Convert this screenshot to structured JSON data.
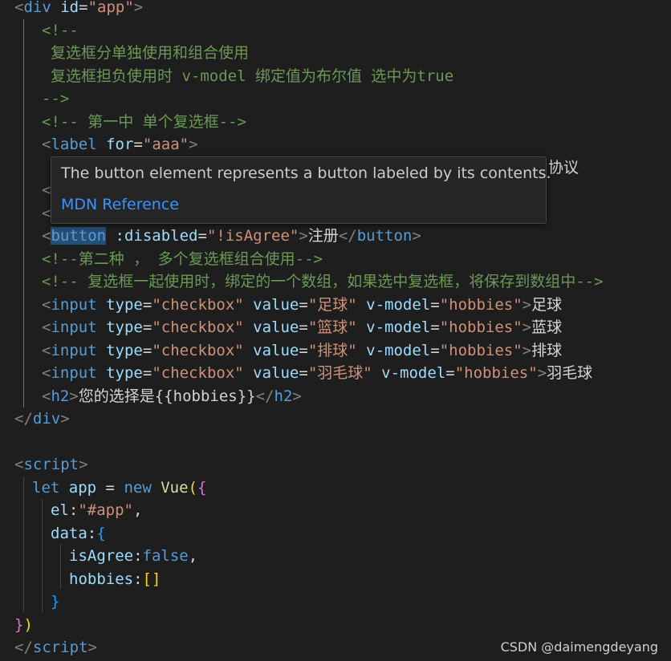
{
  "editor": {
    "lines": [
      [
        [
          "t-punc",
          "<"
        ],
        [
          "t-tag",
          "div"
        ],
        [
          "t-text",
          " "
        ],
        [
          "t-attr",
          "id"
        ],
        [
          "t-text",
          "="
        ],
        [
          "t-str",
          "\"app\""
        ],
        [
          "t-punc",
          ">"
        ]
      ],
      [
        [
          "t-cmt",
          "<!--"
        ]
      ],
      [
        [
          "t-cmt",
          "复选框分单独使用和组合使用"
        ]
      ],
      [
        [
          "t-cmt",
          "复选框担负使用时 v-model 绑定值为布尔值 选中为true"
        ]
      ],
      [
        [
          "t-cmt",
          "-->"
        ]
      ],
      [
        [
          "t-cmt",
          "<!-- 第一中 单个复选框-->"
        ]
      ],
      [
        [
          "t-punc",
          "<"
        ],
        [
          "t-tag",
          "label"
        ],
        [
          "t-text",
          " "
        ],
        [
          "t-attr",
          "for"
        ],
        [
          "t-text",
          "="
        ],
        [
          "t-str",
          "\"aaa\""
        ],
        [
          "t-punc",
          ">"
        ]
      ],
      [
        [
          "t-text",
          "协议"
        ]
      ],
      [
        [
          "t-punc",
          "<"
        ]
      ],
      [
        [
          "t-punc",
          "<"
        ]
      ],
      [
        [
          "t-punc",
          "<"
        ],
        [
          "t-tag sel",
          "button"
        ],
        [
          "t-text",
          " "
        ],
        [
          "t-attr",
          ":disabled"
        ],
        [
          "t-text",
          "="
        ],
        [
          "t-str",
          "\"!isAgree\""
        ],
        [
          "t-punc",
          ">"
        ],
        [
          "t-text",
          "注册"
        ],
        [
          "t-punc",
          "</"
        ],
        [
          "t-tag",
          "button"
        ],
        [
          "t-punc",
          ">"
        ]
      ],
      [
        [
          "t-cmt",
          "<!--第二种 ， 多个复选框组合使用-->"
        ]
      ],
      [
        [
          "t-cmt",
          "<!-- 复选框一起使用时，绑定的一个数组，如果选中复选框，将保存到数组中-->"
        ]
      ],
      [
        [
          "t-punc",
          "<"
        ],
        [
          "t-tag",
          "input"
        ],
        [
          "t-text",
          " "
        ],
        [
          "t-attr",
          "type"
        ],
        [
          "t-text",
          "="
        ],
        [
          "t-str",
          "\"checkbox\""
        ],
        [
          "t-text",
          " "
        ],
        [
          "t-attr",
          "value"
        ],
        [
          "t-text",
          "="
        ],
        [
          "t-str",
          "\"足球\""
        ],
        [
          "t-text",
          " "
        ],
        [
          "t-attr",
          "v-model"
        ],
        [
          "t-text",
          "="
        ],
        [
          "t-str",
          "\"hobbies\""
        ],
        [
          "t-punc",
          ">"
        ],
        [
          "t-text",
          "足球"
        ]
      ],
      [
        [
          "t-punc",
          "<"
        ],
        [
          "t-tag",
          "input"
        ],
        [
          "t-text",
          " "
        ],
        [
          "t-attr",
          "type"
        ],
        [
          "t-text",
          "="
        ],
        [
          "t-str",
          "\"checkbox\""
        ],
        [
          "t-text",
          " "
        ],
        [
          "t-attr",
          "value"
        ],
        [
          "t-text",
          "="
        ],
        [
          "t-str",
          "\"篮球\""
        ],
        [
          "t-text",
          " "
        ],
        [
          "t-attr",
          "v-model"
        ],
        [
          "t-text",
          "="
        ],
        [
          "t-str",
          "\"hobbies\""
        ],
        [
          "t-punc",
          ">"
        ],
        [
          "t-text",
          "蓝球"
        ]
      ],
      [
        [
          "t-punc",
          "<"
        ],
        [
          "t-tag",
          "input"
        ],
        [
          "t-text",
          " "
        ],
        [
          "t-attr",
          "type"
        ],
        [
          "t-text",
          "="
        ],
        [
          "t-str",
          "\"checkbox\""
        ],
        [
          "t-text",
          " "
        ],
        [
          "t-attr",
          "value"
        ],
        [
          "t-text",
          "="
        ],
        [
          "t-str",
          "\"排球\""
        ],
        [
          "t-text",
          " "
        ],
        [
          "t-attr",
          "v-model"
        ],
        [
          "t-text",
          "="
        ],
        [
          "t-str",
          "\"hobbies\""
        ],
        [
          "t-punc",
          ">"
        ],
        [
          "t-text",
          "排球"
        ]
      ],
      [
        [
          "t-punc",
          "<"
        ],
        [
          "t-tag",
          "input"
        ],
        [
          "t-text",
          " "
        ],
        [
          "t-attr",
          "type"
        ],
        [
          "t-text",
          "="
        ],
        [
          "t-str",
          "\"checkbox\""
        ],
        [
          "t-text",
          " "
        ],
        [
          "t-attr",
          "value"
        ],
        [
          "t-text",
          "="
        ],
        [
          "t-str",
          "\"羽毛球\""
        ],
        [
          "t-text",
          " "
        ],
        [
          "t-attr",
          "v-model"
        ],
        [
          "t-text",
          "="
        ],
        [
          "t-str",
          "\"hobbies\""
        ],
        [
          "t-punc",
          ">"
        ],
        [
          "t-text",
          "羽毛球"
        ]
      ],
      [
        [
          "t-punc",
          "<"
        ],
        [
          "t-tag",
          "h2"
        ],
        [
          "t-punc",
          ">"
        ],
        [
          "t-text",
          "您的选择是{{hobbies}}"
        ],
        [
          "t-punc",
          "</"
        ],
        [
          "t-tag",
          "h2"
        ],
        [
          "t-punc",
          ">"
        ]
      ],
      [
        [
          "t-punc",
          "</"
        ],
        [
          "t-tag",
          "div"
        ],
        [
          "t-punc",
          ">"
        ]
      ],
      [],
      [
        [
          "t-punc",
          "<"
        ],
        [
          "t-tag",
          "script"
        ],
        [
          "t-punc",
          ">"
        ]
      ],
      [
        [
          "t-kw",
          "let"
        ],
        [
          "t-text",
          " "
        ],
        [
          "t-var",
          "app"
        ],
        [
          "t-text",
          " = "
        ],
        [
          "t-kw",
          "new"
        ],
        [
          "t-text",
          " "
        ],
        [
          "t-fn",
          "Vue"
        ],
        [
          "t-b1",
          "("
        ],
        [
          "t-b2",
          "{"
        ]
      ],
      [
        [
          "t-var",
          "el"
        ],
        [
          "t-text",
          ":"
        ],
        [
          "t-str",
          "\"#app\""
        ],
        [
          "t-text",
          ","
        ]
      ],
      [
        [
          "t-var",
          "data"
        ],
        [
          "t-text",
          ":"
        ],
        [
          "t-b3",
          "{"
        ]
      ],
      [
        [
          "t-var",
          "isAgree"
        ],
        [
          "t-text",
          ":"
        ],
        [
          "t-kw",
          "false"
        ],
        [
          "t-text",
          ","
        ]
      ],
      [
        [
          "t-var",
          "hobbies"
        ],
        [
          "t-text",
          ":"
        ],
        [
          "t-b1",
          "[]"
        ]
      ],
      [
        [
          "t-b3",
          "}"
        ]
      ],
      [
        [
          "t-b2",
          "}"
        ],
        [
          "t-b1",
          ")"
        ]
      ],
      [
        [
          "t-punc",
          "</"
        ],
        [
          "t-tag",
          "script"
        ],
        [
          "t-punc",
          ">"
        ]
      ]
    ]
  },
  "hover": {
    "description": "The button element represents a button labeled by its contents.",
    "reference_link": "MDN Reference"
  },
  "watermark": "CSDN @daimengdeyang"
}
